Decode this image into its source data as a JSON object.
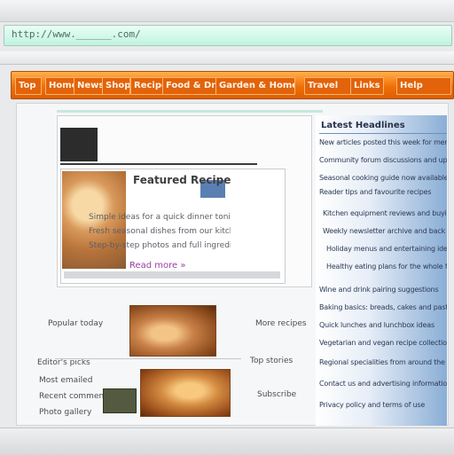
{
  "browser": {
    "address": "http://www.______.com/"
  },
  "nav": {
    "items": [
      "Top",
      "Home",
      "News",
      "Shop",
      "Recipes",
      "Food & Drink",
      "Garden & Home",
      "Travel",
      "Links",
      "Help"
    ]
  },
  "promo": {
    "title": "Featured Recipe",
    "lines": [
      "Simple ideas for a quick dinner tonight",
      "Fresh seasonal dishes from our kitchen",
      "Step-by-step photos and full ingredient list"
    ],
    "link": "Read more »"
  },
  "sidebar": {
    "heading": "Latest Headlines",
    "lines": [
      "New articles posted this week for members",
      "Community forum discussions and updates",
      "Seasonal cooking guide now available",
      "Reader tips and favourite recipes",
      "Kitchen equipment reviews and buying guide",
      "Weekly newsletter archive and back issues",
      "Holiday menus and entertaining ideas",
      "Healthy eating plans for the whole family",
      "Wine and drink pairing suggestions",
      "Baking basics: breads, cakes and pastry",
      "Quick lunches and lunchbox ideas",
      "Vegetarian and vegan recipe collection",
      "Regional specialities from around the world",
      "Contact us and advertising information",
      "Privacy policy and terms of use"
    ]
  },
  "lower": {
    "left_labels": [
      "Popular today",
      "Editor's picks",
      "Most emailed",
      "Recent comments",
      "Photo gallery"
    ],
    "mid_labels": [
      "More recipes",
      "Top stories",
      "Subscribe"
    ]
  }
}
